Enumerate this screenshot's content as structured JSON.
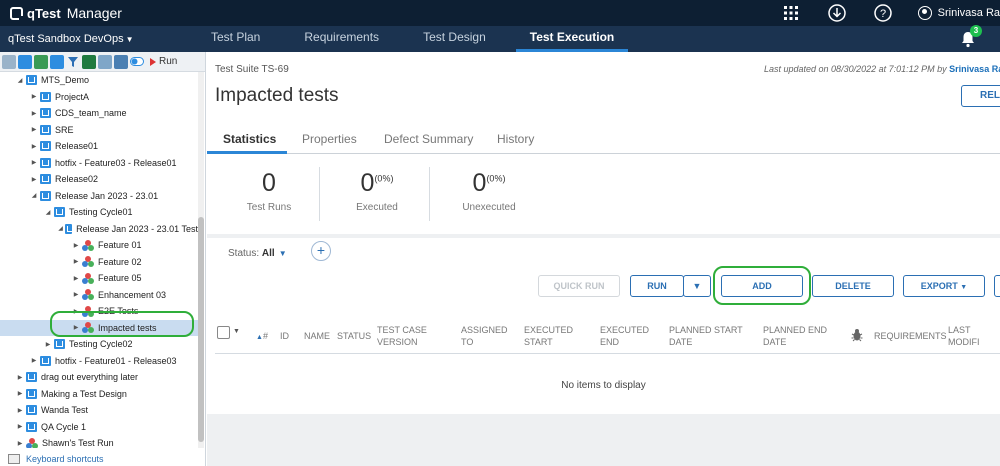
{
  "topbar": {
    "brand": "qTest",
    "app_name": "Manager",
    "icons": [
      "grid-icon",
      "download-icon",
      "help-icon"
    ],
    "user_name": "Srinivasa Ra"
  },
  "navbar": {
    "project": "qTest Sandbox DevOps",
    "tabs": [
      {
        "label": "Test Plan"
      },
      {
        "label": "Requirements"
      },
      {
        "label": "Test Design"
      },
      {
        "label": "Test Execution"
      }
    ],
    "notification_count": "3"
  },
  "toolbar": {
    "run_label": "Run"
  },
  "tree": [
    {
      "label": "MTS_Demo",
      "type": "folder",
      "depth": 1,
      "expanded": true
    },
    {
      "label": "ProjectA",
      "type": "folder",
      "depth": 2,
      "expanded": false
    },
    {
      "label": "CDS_team_name",
      "type": "folder",
      "depth": 2,
      "expanded": false
    },
    {
      "label": "SRE",
      "type": "folder",
      "depth": 2,
      "expanded": false
    },
    {
      "label": "Release01",
      "type": "folder",
      "depth": 2,
      "expanded": false
    },
    {
      "label": "hotfix - Feature03 - Release01",
      "type": "folder",
      "depth": 2,
      "expanded": false
    },
    {
      "label": "Release02",
      "type": "folder",
      "depth": 2,
      "expanded": false
    },
    {
      "label": "Release Jan 2023 - 23.01",
      "type": "folder",
      "depth": 2,
      "expanded": true
    },
    {
      "label": "Testing Cycle01",
      "type": "folder",
      "depth": 3,
      "expanded": true
    },
    {
      "label": "Release Jan 2023 - 23.01 Test",
      "type": "folder",
      "depth": 4,
      "expanded": true
    },
    {
      "label": "Feature 01",
      "type": "suite",
      "depth": 5,
      "expanded": false
    },
    {
      "label": "Feature 02",
      "type": "suite",
      "depth": 5,
      "expanded": false
    },
    {
      "label": "Feature 05",
      "type": "suite",
      "depth": 5,
      "expanded": false
    },
    {
      "label": "Enhancement 03",
      "type": "suite",
      "depth": 5,
      "expanded": false
    },
    {
      "label": "E2E Tests",
      "type": "suite",
      "depth": 5,
      "expanded": false
    },
    {
      "label": "Impacted tests",
      "type": "suite",
      "depth": 5,
      "expanded": false,
      "selected": true
    },
    {
      "label": "Testing Cycle02",
      "type": "folder",
      "depth": 3,
      "expanded": false
    },
    {
      "label": "hotfix - Feature01 - Release03",
      "type": "folder",
      "depth": 2,
      "expanded": false
    },
    {
      "label": "drag out everything later",
      "type": "folder",
      "depth": 1,
      "expanded": false
    },
    {
      "label": "Making a Test Design",
      "type": "folder",
      "depth": 1,
      "expanded": false
    },
    {
      "label": "Wanda Test",
      "type": "folder",
      "depth": 1,
      "expanded": false
    },
    {
      "label": "QA Cycle 1",
      "type": "folder",
      "depth": 1,
      "expanded": false
    },
    {
      "label": "Shawn's Test Run",
      "type": "suite",
      "depth": 1,
      "expanded": false
    }
  ],
  "footer": {
    "keyboard_shortcuts": "Keyboard shortcuts"
  },
  "main": {
    "breadcrumb_type": "Test Suite",
    "breadcrumb_id": "TS-69",
    "updated_prefix": "Last updated on 08/30/2022 at 7:01:12 PM by",
    "updated_user": "Srinivasa Ra",
    "title": "Impacted tests",
    "reload_label": "RELO",
    "tabs": [
      "Statistics",
      "Properties",
      "Defect Summary",
      "History"
    ],
    "stats": [
      {
        "value": "0",
        "percent": "",
        "label": "Test Runs"
      },
      {
        "value": "0",
        "percent": "(0%)",
        "label": "Executed"
      },
      {
        "value": "0",
        "percent": "(0%)",
        "label": "Unexecuted"
      }
    ],
    "status_label": "Status:",
    "status_value": "All",
    "buttons": {
      "quick_run": "QUICK RUN",
      "run": "RUN",
      "add": "ADD",
      "delete": "DELETE",
      "export": "EXPORT"
    },
    "columns": [
      "#",
      "ID",
      "NAME",
      "STATUS",
      "TEST CASE VERSION",
      "ASSIGNED TO",
      "EXECUTED START",
      "EXECUTED END",
      "PLANNED START DATE",
      "PLANNED END DATE",
      "REQUIREMENTS",
      "LAST MODIFI DATE"
    ],
    "empty_message": "No items to display"
  },
  "colors": {
    "topbar": "#0d1f33",
    "navbar": "#1b3350",
    "accent": "#2b86d6",
    "highlight_circle": "#2fae3a"
  }
}
